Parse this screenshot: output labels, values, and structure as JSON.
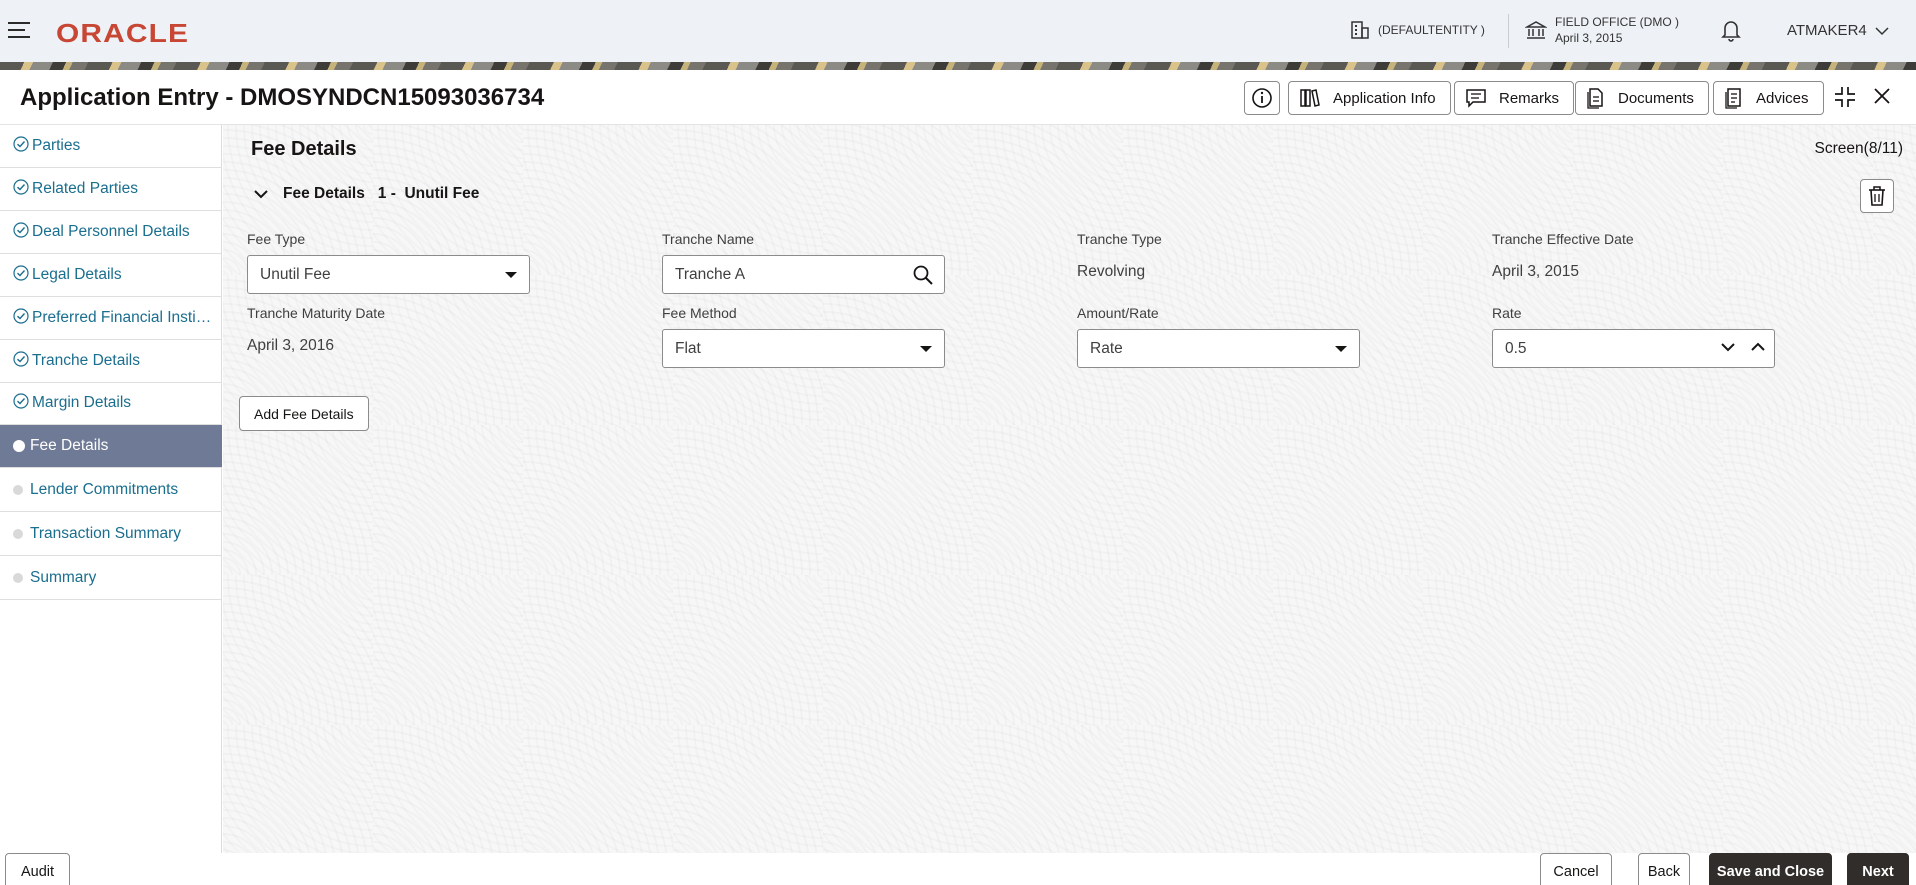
{
  "topbar": {
    "logo": "ORACLE",
    "entity": "(DEFAULTENTITY )",
    "office_name": "FIELD OFFICE (DMO )",
    "office_date": "April 3, 2015",
    "user": "ATMAKER4"
  },
  "header": {
    "title": "Application Entry - DMOSYNDCN15093036734",
    "buttons": {
      "application_info": "Application Info",
      "remarks": "Remarks",
      "documents": "Documents",
      "advices": "Advices"
    }
  },
  "sidebar": {
    "items": [
      {
        "label": "Parties",
        "state": "done"
      },
      {
        "label": "Related Parties",
        "state": "done"
      },
      {
        "label": "Deal Personnel Details",
        "state": "done"
      },
      {
        "label": "Legal Details",
        "state": "done"
      },
      {
        "label": "Preferred Financial Institutions",
        "state": "done"
      },
      {
        "label": "Tranche Details",
        "state": "done"
      },
      {
        "label": "Margin Details",
        "state": "done"
      },
      {
        "label": "Fee Details",
        "state": "active"
      },
      {
        "label": "Lender Commitments",
        "state": "pending"
      },
      {
        "label": "Transaction Summary",
        "state": "pending"
      },
      {
        "label": "Summary",
        "state": "pending"
      }
    ]
  },
  "main": {
    "section_title": "Fee Details",
    "screen_count": "Screen(8/11)",
    "fee_header": "Fee Details   1 -  Unutil Fee",
    "fields": {
      "fee_type": {
        "label": "Fee Type",
        "value": "Unutil Fee"
      },
      "tranche_name": {
        "label": "Tranche Name",
        "value": "Tranche A"
      },
      "tranche_type": {
        "label": "Tranche Type",
        "value": "Revolving"
      },
      "tranche_effective_date": {
        "label": "Tranche Effective Date",
        "value": "April 3, 2015"
      },
      "tranche_maturity_date": {
        "label": "Tranche Maturity Date",
        "value": "April 3, 2016"
      },
      "fee_method": {
        "label": "Fee Method",
        "value": "Flat"
      },
      "amount_rate": {
        "label": "Amount/Rate",
        "value": "Rate"
      },
      "rate": {
        "label": "Rate",
        "value": "0.5"
      }
    },
    "add_fee_button": "Add Fee Details"
  },
  "footer": {
    "audit": "Audit",
    "cancel": "Cancel",
    "back": "Back",
    "save_close": "Save and Close",
    "next": "Next"
  },
  "colors": {
    "brand": "#c74634",
    "link": "#1a6e8e",
    "active_nav": "#6f7a96",
    "primary_button": "#312d2a"
  }
}
